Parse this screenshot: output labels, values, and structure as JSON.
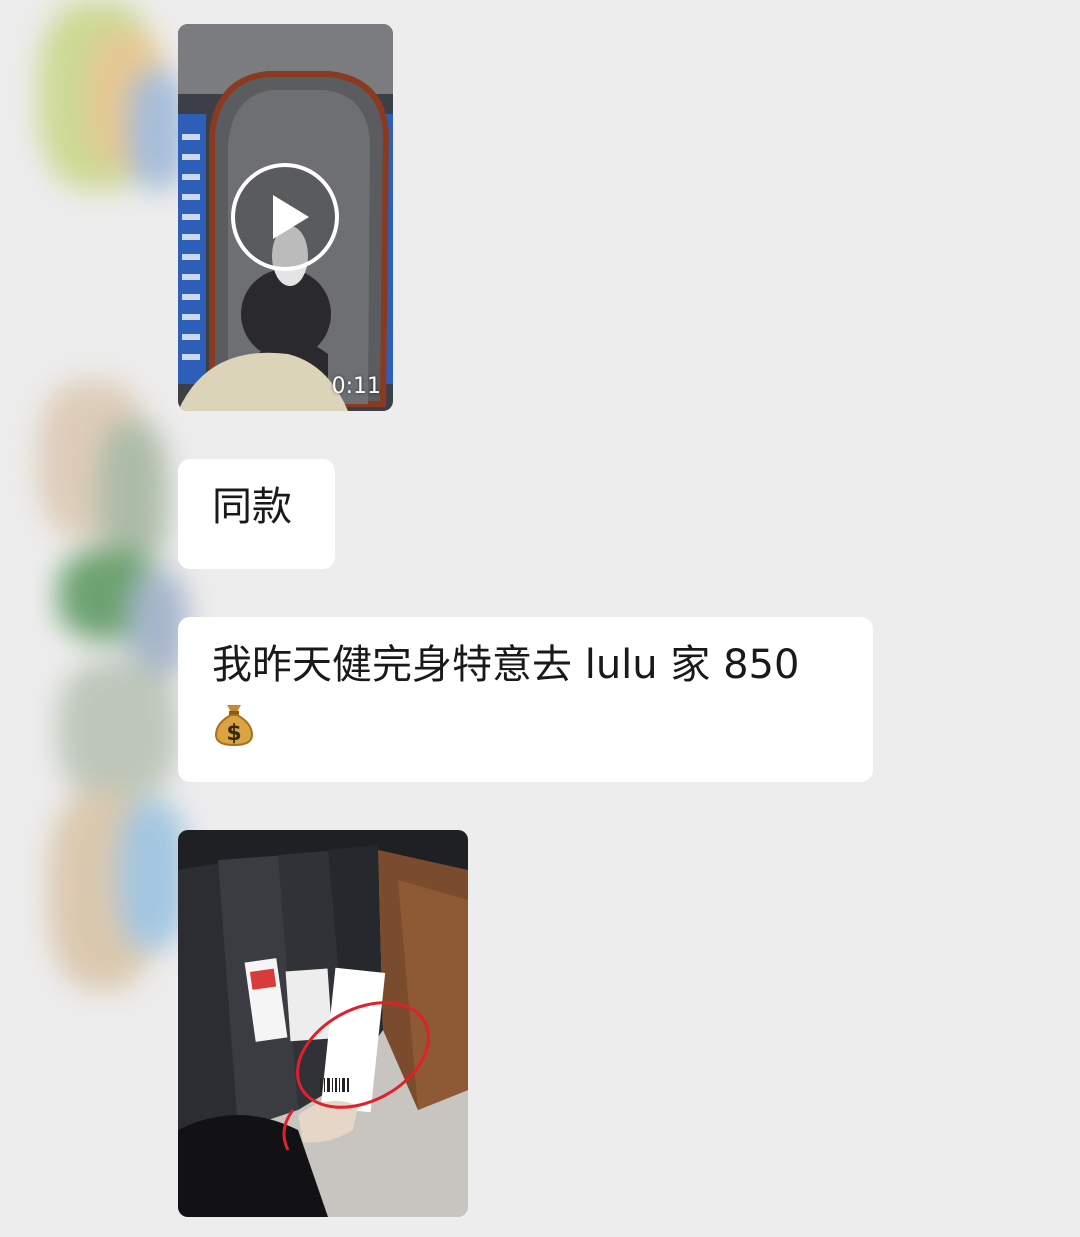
{
  "messages": {
    "video": {
      "duration": "0:11",
      "play_icon": "play-icon"
    },
    "text1": {
      "text": "同款"
    },
    "text2": {
      "text": "我昨天健完身特意去 lulu 家 850",
      "emoji": "money-bag-emoji"
    },
    "photo": {
      "subject": "clothing-rack-price-tag-photo"
    }
  },
  "colors": {
    "background": "#ededed",
    "bubble": "#ffffff",
    "text": "#191919",
    "annotation_red": "#e0202a"
  }
}
